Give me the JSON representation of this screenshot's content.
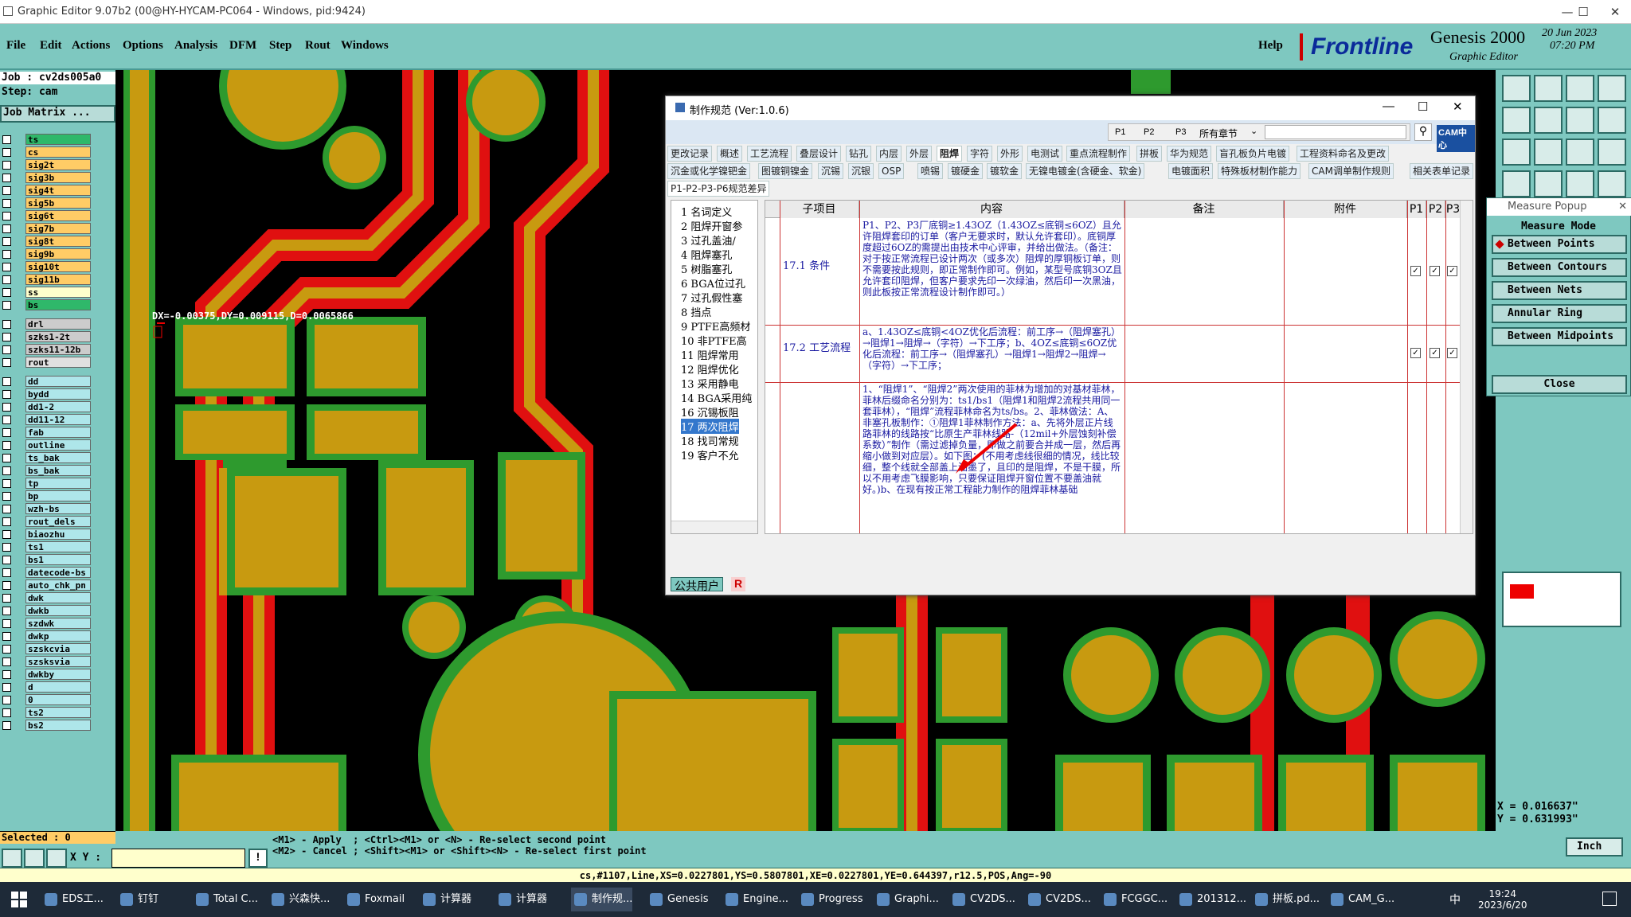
{
  "window": {
    "title": "Graphic Editor 9.07b2 (00@HY-HYCAM-PC064 - Windows, pid:9424)",
    "min": "—",
    "max": "☐",
    "close": "✕"
  },
  "menu": [
    "File",
    "Edit",
    "Actions",
    "Options",
    "Analysis",
    "DFM",
    "Step",
    "Rout",
    "Windows"
  ],
  "help": "Help",
  "brand": {
    "logo": "Frontline",
    "product": "Genesis 2000",
    "sub": "Graphic Editor",
    "date": "20 Jun 2023",
    "time": "07:20 PM"
  },
  "job": {
    "job": "Job : cv2ds005a0",
    "step": "Step: cam",
    "matrix": "Job Matrix ..."
  },
  "layers_top": [
    {
      "name": "ts",
      "color": "#2fb86a"
    },
    {
      "name": "cs",
      "color": "#ffcc66"
    },
    {
      "name": "sig2t",
      "color": "#ffcc66"
    },
    {
      "name": "sig3b",
      "color": "#ffcc66"
    },
    {
      "name": "sig4t",
      "color": "#ffcc66"
    },
    {
      "name": "sig5b",
      "color": "#ffcc66"
    },
    {
      "name": "sig6t",
      "color": "#ffcc66"
    },
    {
      "name": "sig7b",
      "color": "#ffcc66"
    },
    {
      "name": "sig8t",
      "color": "#ffcc66"
    },
    {
      "name": "sig9b",
      "color": "#ffcc66"
    },
    {
      "name": "sig10t",
      "color": "#ffcc66"
    },
    {
      "name": "sig11b",
      "color": "#ffcc66"
    },
    {
      "name": "ss",
      "color": "#ffffcc"
    },
    {
      "name": "bs",
      "color": "#2fb86a"
    }
  ],
  "layers_mid": [
    {
      "name": "drl",
      "color": "#cccccc"
    },
    {
      "name": "szks1-2t",
      "color": "#cccccc"
    },
    {
      "name": "szks11-12b",
      "color": "#cccccc"
    },
    {
      "name": "rout",
      "color": "#e0e0e0"
    }
  ],
  "layers_bot": [
    "dd",
    "bydd",
    "dd1-2",
    "dd11-12",
    "fab",
    "outline",
    "ts_bak",
    "bs_bak",
    "tp",
    "bp",
    "wzh-bs",
    "rout_dels",
    "biaozhu",
    "ts1",
    "bs1",
    "datecode-bs",
    "auto_chk_pn",
    "dwk",
    "dwkb",
    "szdwk",
    "dwkp",
    "szskcvia",
    "szsksvia",
    "dwkby",
    "d",
    "0",
    "ts2",
    "bs2"
  ],
  "selected": "Selected : 0",
  "measure_text": "DX=-0.00375,DY=0.009115,D=0.0065866",
  "dialog": {
    "title": "制作规范 (Ver:1.0.6)",
    "search": {
      "p1": "P1",
      "p2": "P2",
      "p3": "P3",
      "scope": "所有章节",
      "badge": "CAM中心"
    },
    "tabs1": [
      "更改记录",
      "概述",
      "工艺流程",
      "叠层设计",
      "钻孔",
      "内层",
      "外层",
      "阻焊",
      "字符",
      "外形",
      "电测试",
      "重点流程制作",
      "拼板",
      "华为规范",
      "盲孔板负片电镀",
      "工程资料命名及更改"
    ],
    "tabs2": [
      "沉金或化学镍钯金",
      "图镀铜镍金",
      "沉锡",
      "沉银",
      "OSP",
      "喷锡",
      "镀硬金",
      "镀软金",
      "无镍电镀金(含硬金、软金)",
      "电镀面积",
      "特殊板材制作能力",
      "CAM调单制作规则",
      "相关表单记录"
    ],
    "tabs3": "P1-P2-P3-P6规范差异",
    "tree": [
      "1 名词定义",
      "2 阻焊开窗参",
      "3 过孔盖油/",
      "4 阻焊塞孔",
      "5 树脂塞孔",
      "6 BGA位过孔",
      "7 过孔假性塞",
      "8 挡点",
      "9 PTFE高频材",
      "10 非PTFE高",
      "11 阻焊常用",
      "12 阻焊优化",
      "13 采用静电",
      "14 BGA采用纯",
      "16 沉锡板阻",
      "17 两次阻焊",
      "18 找司常规",
      "19 客户不允"
    ],
    "headers": [
      "子项目",
      "内容",
      "备注",
      "附件",
      "P1",
      "P2",
      "P3"
    ],
    "rows": [
      {
        "item": "17.1 条件",
        "content": "P1、P2、P3厂底铜≥1.43OZ（1.43OZ≤底铜≤6OZ）且允许阻焊套印的订单（客户无要求时，默认允许套印）。底铜厚度超过6OZ的需提出由技术中心评审，并给出做法。（备注：对于按正常流程已设计两次（或多次）阻焊的厚铜板订单，则不需要按此规则，即正常制作即可。例如，某型号底铜3OZ且允许套印阻焊，但客户要求先印一次绿油，然后印一次黑油，则此板按正常流程设计制作即可。）"
      },
      {
        "item": "17.2 工艺流程",
        "content": "a、1.43OZ≤底铜<4OZ优化后流程：前工序→（阻焊塞孔）→阻焊1→阻焊→（字符）→下工序；b、4OZ≤底铜≤6OZ优化后流程：前工序→（阻焊塞孔）→阻焊1→阻焊2→阻焊→（字符）→下工序；"
      },
      {
        "item": "",
        "content": "1、“阻焊1”、“阻焊2”两次使用的菲林为增加的对基材菲林，菲林后缀命名分别为：ts1/bs1（阻焊1和阻焊2流程共用同一套菲林），“阻焊”流程菲林命名为ts/bs。2、菲林做法：A、非塞孔板制作：①阻焊1菲林制作方法：a、先将外层正片线路菲林的线路按“比原生产菲林线路-（12mil+外层蚀刻补偿系数）”制作（需过滤掉负量，即做之前要合并成一层，然后再缩小做到对应层）。如下图：(不用考虑线很细的情况，线比较细，整个线就全部盖上油墨了，且印的是阻焊，不是干膜，所以不用考虑飞膜影响，只要保证阻焊开窗位置不要盖油就好。)b、在现有按正常工程能力制作的阻焊菲林基础"
      }
    ],
    "footer": {
      "user": "公共用户",
      "r": "R"
    }
  },
  "measure_popup": {
    "title": "Measure Popup",
    "mode": "Measure Mode",
    "buttons": [
      "Between Points",
      "Between Contours",
      "Between Nets",
      "Annular Ring",
      "Between Midpoints"
    ],
    "close": "Close"
  },
  "coords": {
    "x": "X = 0.016637\"",
    "y": "Y = 0.631993\""
  },
  "prompt": {
    "l1": "<M1> - Apply  ; <Ctrl><M1> or <N> - Re-select second point",
    "l2": "<M2> - Cancel ; <Shift><M1> or <Shift><N> - Re-select first point"
  },
  "xy_label": "X Y :",
  "units": "Inch",
  "status": "cs,#1107,Line,XS=0.0227801,YS=0.5807801,XE=0.0227801,YE=0.644397,r12.5,POS,Ang=-90",
  "taskbar": [
    "EDS工...",
    "钉钉",
    "Total C...",
    "兴森快...",
    "Foxmail",
    "计算器",
    "计算器",
    "制作规...",
    "Genesis",
    "Engine...",
    "Progress",
    "Graphi...",
    "CV2DS...",
    "CV2DS...",
    "FCGGC...",
    "201312...",
    "拼板.pd...",
    "CAM_G..."
  ],
  "clock": {
    "time": "19:24",
    "date": "2023/6/20"
  },
  "tray": [
    "中"
  ]
}
